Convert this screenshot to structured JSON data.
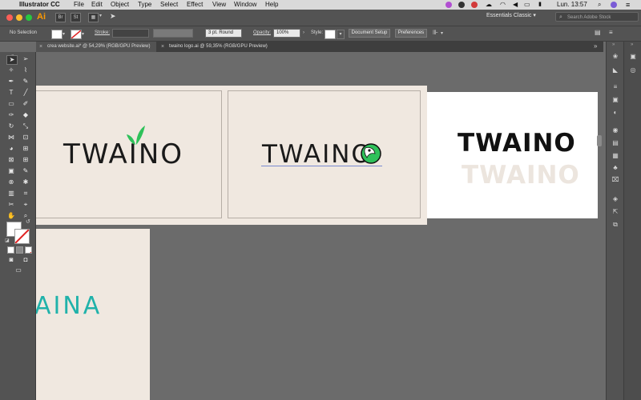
{
  "menubar": {
    "app_name": "Illustrator CC",
    "menus": [
      "File",
      "Edit",
      "Object",
      "Type",
      "Select",
      "Effect",
      "View",
      "Window",
      "Help"
    ],
    "clock": "Lun. 13:57"
  },
  "appbar": {
    "logo": "Ai",
    "workspace": "Essentials Classic",
    "workspace_arrow": "▾",
    "search_placeholder": "Search Adobe Stock"
  },
  "control_bar": {
    "selection_label": "No Selection",
    "stroke_label": "Stroke:",
    "stroke_value": "",
    "brush_label": "3 pt. Round",
    "opacity_label": "Opacity:",
    "opacity_value": "100%",
    "style_label": "Style:",
    "document_setup": "Document Setup",
    "preferences": "Preferences"
  },
  "tabs": [
    {
      "label": "crea website.ai* @ 54,29% (RGB/GPU Preview)",
      "active": true
    },
    {
      "label": "twaino logo.ai @ 59,35% (RGB/GPU Preview)",
      "active": false
    }
  ],
  "artboards": {
    "logo1_text": "TWAINO",
    "logo2_text": "TWAINO",
    "logo3_bold": "TWAINO",
    "logo3_faded": "TWAINO",
    "logo4_text": "AINA"
  },
  "colors": {
    "accent_green": "#2fc15a",
    "artboard_bg": "#f0e8e0",
    "teal": "#20b2aa",
    "ai_orange": "#ff9a00"
  }
}
